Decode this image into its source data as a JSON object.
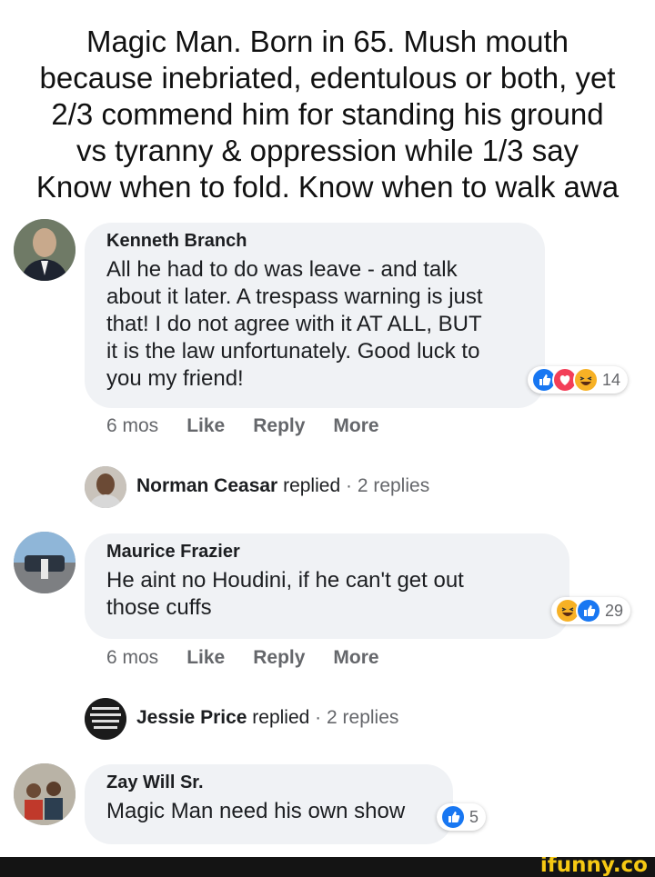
{
  "caption": {
    "lines": [
      "Magic Man. Born in 65. Mush mouth",
      "because inebriated, edentulous or both, yet",
      "2/3  commend him for standing his ground",
      "vs tyranny & oppression  while 1/3 say",
      "Know when to fold. Know when to walk awa"
    ]
  },
  "comments": [
    {
      "author": "Kenneth Branch",
      "text_lines": [
        "All he had to do was leave - and talk",
        "about it later. A trespass warning is just",
        "that! I do not agree with it AT ALL, BUT",
        "it is the law unfortunately. Good luck to",
        "you my friend!"
      ],
      "reaction_icons": [
        "like-icon",
        "love-icon",
        "haha-icon"
      ],
      "reaction_count": "14",
      "time": "6 mos",
      "like": "Like",
      "reply": "Reply",
      "more": "More",
      "reply_preview": {
        "name": "Norman Ceasar",
        "verb": "replied",
        "sep": "·",
        "count": "2 replies"
      }
    },
    {
      "author": "Maurice Frazier",
      "text_lines": [
        "He aint no Houdini, if he can't get out",
        "those cuffs"
      ],
      "reaction_icons": [
        "haha-icon",
        "like-icon"
      ],
      "reaction_count": "29",
      "time": "6 mos",
      "like": "Like",
      "reply": "Reply",
      "more": "More",
      "reply_preview": {
        "name": "Jessie Price",
        "verb": "replied",
        "sep": "·",
        "count": "2 replies"
      }
    },
    {
      "author": "Zay Will Sr.",
      "text_lines": [
        "Magic Man need his own show"
      ],
      "reaction_icons": [
        "like-icon"
      ],
      "reaction_count": "5"
    }
  ],
  "footer": {
    "logo": "ifunny.co",
    "logo_color": "#f6c913"
  },
  "colors": {
    "like": "#1877f2",
    "love": "#f33e58",
    "haha": "#f7b125",
    "bubble": "#f0f2f5",
    "meta": "#65676b"
  }
}
